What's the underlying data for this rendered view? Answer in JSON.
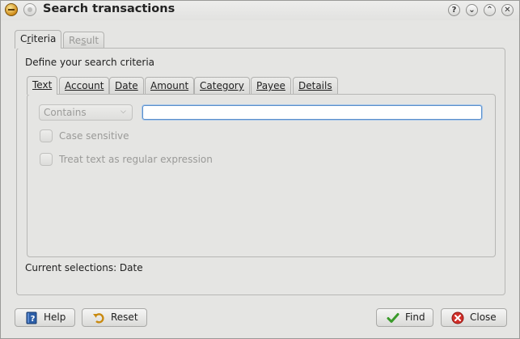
{
  "window": {
    "title": "Search transactions",
    "title_buttons": [
      {
        "name": "help-icon",
        "glyph": "?"
      },
      {
        "name": "minimize-icon",
        "glyph": "⌄"
      },
      {
        "name": "maximize-icon",
        "glyph": "⌃"
      },
      {
        "name": "close-window-icon",
        "glyph": "✕"
      }
    ]
  },
  "top_tabs": [
    {
      "label": "Criteria",
      "underline": "r",
      "active": true
    },
    {
      "label": "Result",
      "underline": "s",
      "active": false,
      "disabled": true
    }
  ],
  "criteria": {
    "heading": "Define your search criteria",
    "tabs": [
      {
        "label": "Text",
        "active": true
      },
      {
        "label": "Account"
      },
      {
        "label": "Date"
      },
      {
        "label": "Amount"
      },
      {
        "label": "Category"
      },
      {
        "label": "Payee"
      },
      {
        "label": "Details"
      }
    ],
    "text": {
      "match_select": "Contains",
      "search_value": "",
      "case_sensitive_label": "Case sensitive",
      "regex_label": "Treat text as regular expression"
    },
    "current_selections": "Current selections: Date"
  },
  "buttons": {
    "help": "Help",
    "reset": "Reset",
    "find": "Find",
    "close": "Close"
  },
  "colors": {
    "accent": "#5a8fcb",
    "find_icon": "#3a9a2a",
    "close_icon": "#d2302a"
  }
}
